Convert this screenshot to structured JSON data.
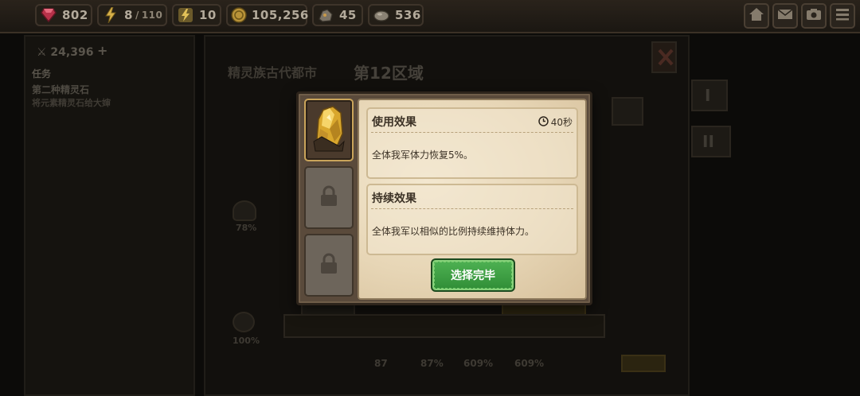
{
  "resources": {
    "gems": {
      "value": "802",
      "icon": "gem-icon"
    },
    "stamina": {
      "current": "8",
      "separator": "/",
      "max": "110",
      "icon": "lightning-icon"
    },
    "energy": {
      "value": "10",
      "icon": "flash-icon"
    },
    "gold": {
      "value": "105,256",
      "icon": "coin-icon"
    },
    "ore": {
      "value": "45",
      "icon": "ore-icon"
    },
    "stone": {
      "value": "536",
      "icon": "stone-icon"
    }
  },
  "top_buttons": [
    "home-icon",
    "mail-icon",
    "camera-icon",
    "menu-icon"
  ],
  "background": {
    "power": "⚔ 24,396",
    "plus": "+",
    "quest_label": "任务",
    "quest_name": "第二种精灵石",
    "quest_desc": "将元素精灵石给大婶",
    "location": "精灵族古代都市",
    "zone": "第12区域",
    "left_pct_1": "78%",
    "left_pct_2": "100%",
    "roman_1": "I",
    "roman_2": "II",
    "stats": [
      "87",
      "87%",
      "609%",
      "609%"
    ]
  },
  "dialog": {
    "slot_icon": "golden-crystal-icon",
    "locked_icon": "lock-icon",
    "active_effect": {
      "title": "使用效果",
      "duration": "40秒",
      "description": "全体我军体力恢复5%。"
    },
    "passive_effect": {
      "title": "持续效果",
      "description": "全体我军以相似的比例持续维持体力。"
    },
    "confirm_label": "选择完毕"
  },
  "colors": {
    "confirm_green": "#3fa345",
    "gem_red": "#c0304a",
    "gold_yellow": "#e0b94a"
  }
}
